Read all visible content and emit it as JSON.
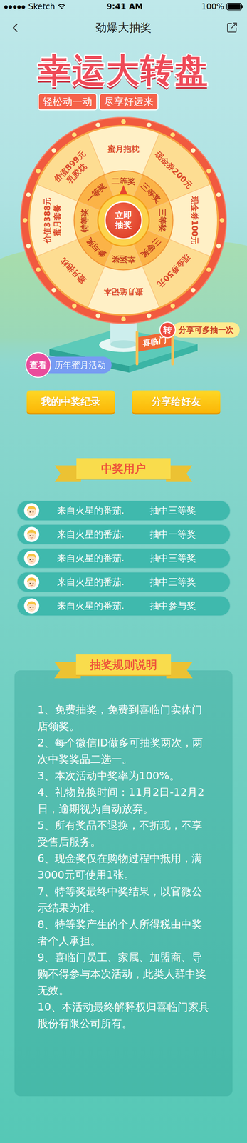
{
  "status_bar": {
    "signal": "●●●●●",
    "carrier": "Sketch",
    "time": "9:41 AM",
    "battery": "100%"
  },
  "nav": {
    "title": "劲爆大抽奖"
  },
  "hero": {
    "title": "幸运大转盘",
    "slogans": [
      "轻松动一动",
      "尽享好运来"
    ]
  },
  "wheel": {
    "segments": [
      {
        "level": "二等奖",
        "prize": [
          "蜜月抱枕"
        ]
      },
      {
        "level": "三等奖",
        "prize": [
          "现金券200元"
        ]
      },
      {
        "level": "三等奖",
        "prize": [
          "现金券100元"
        ]
      },
      {
        "level": "三等奖",
        "prize": [
          "现金券50元"
        ]
      },
      {
        "level": "幸运奖",
        "prize": [
          "蜜月笔记本"
        ]
      },
      {
        "level": "参与奖",
        "prize": [
          "蜜月抱枕"
        ]
      },
      {
        "level": "特等奖",
        "prize": [
          "价值3388元",
          "蜜月套餐"
        ]
      },
      {
        "level": "一等奖",
        "prize": [
          "价值899元",
          "乳胶枕"
        ]
      }
    ],
    "button": [
      "立即",
      "抽奖"
    ]
  },
  "share_badge": {
    "icon": "转",
    "text": "分享可多抽一次"
  },
  "history_button": {
    "tag": "查看",
    "label": "历年蜜月活动"
  },
  "sign": {
    "brand": "喜临门"
  },
  "actions": [
    "我的中奖纪录",
    "分享给好友"
  ],
  "winners": {
    "title": "中奖用户",
    "rows": [
      {
        "user": "来自火星的番茄.",
        "prize": "抽中三等奖"
      },
      {
        "user": "来自火星的番茄.",
        "prize": "抽中一等奖"
      },
      {
        "user": "来自火星的番茄.",
        "prize": "抽中三等奖"
      },
      {
        "user": "来自火星的番茄.",
        "prize": "抽中三等奖"
      },
      {
        "user": "来自火星的番茄.",
        "prize": "抽中参与奖"
      }
    ]
  },
  "rules": {
    "title": "抽奖规则说明",
    "items": [
      "1、免费抽奖，免费到喜临门实体门店领奖。",
      "2、每个微信ID做多可抽奖两次，两次中奖奖品二选一。",
      "3、本次活动中奖率为100%。",
      "4、礼物兑换时间：11月2日-12月2日，逾期视为自动放弃。",
      "5、所有奖品不退换，不折现，不享受售后服务。",
      "6、现金奖仅在购物过程中抵用，满3000元可使用1张。",
      "7、特等奖最终中奖结果，以官微公示结果为准。",
      "8、特等奖产生的个人所得税由中奖者个人承担。",
      "9、喜临门员工、家属、加盟商、导购不得参与本次活动，此类人群中奖无效。",
      "10、本活动最终解释权归喜临门家具股份有限公司所有。"
    ]
  }
}
